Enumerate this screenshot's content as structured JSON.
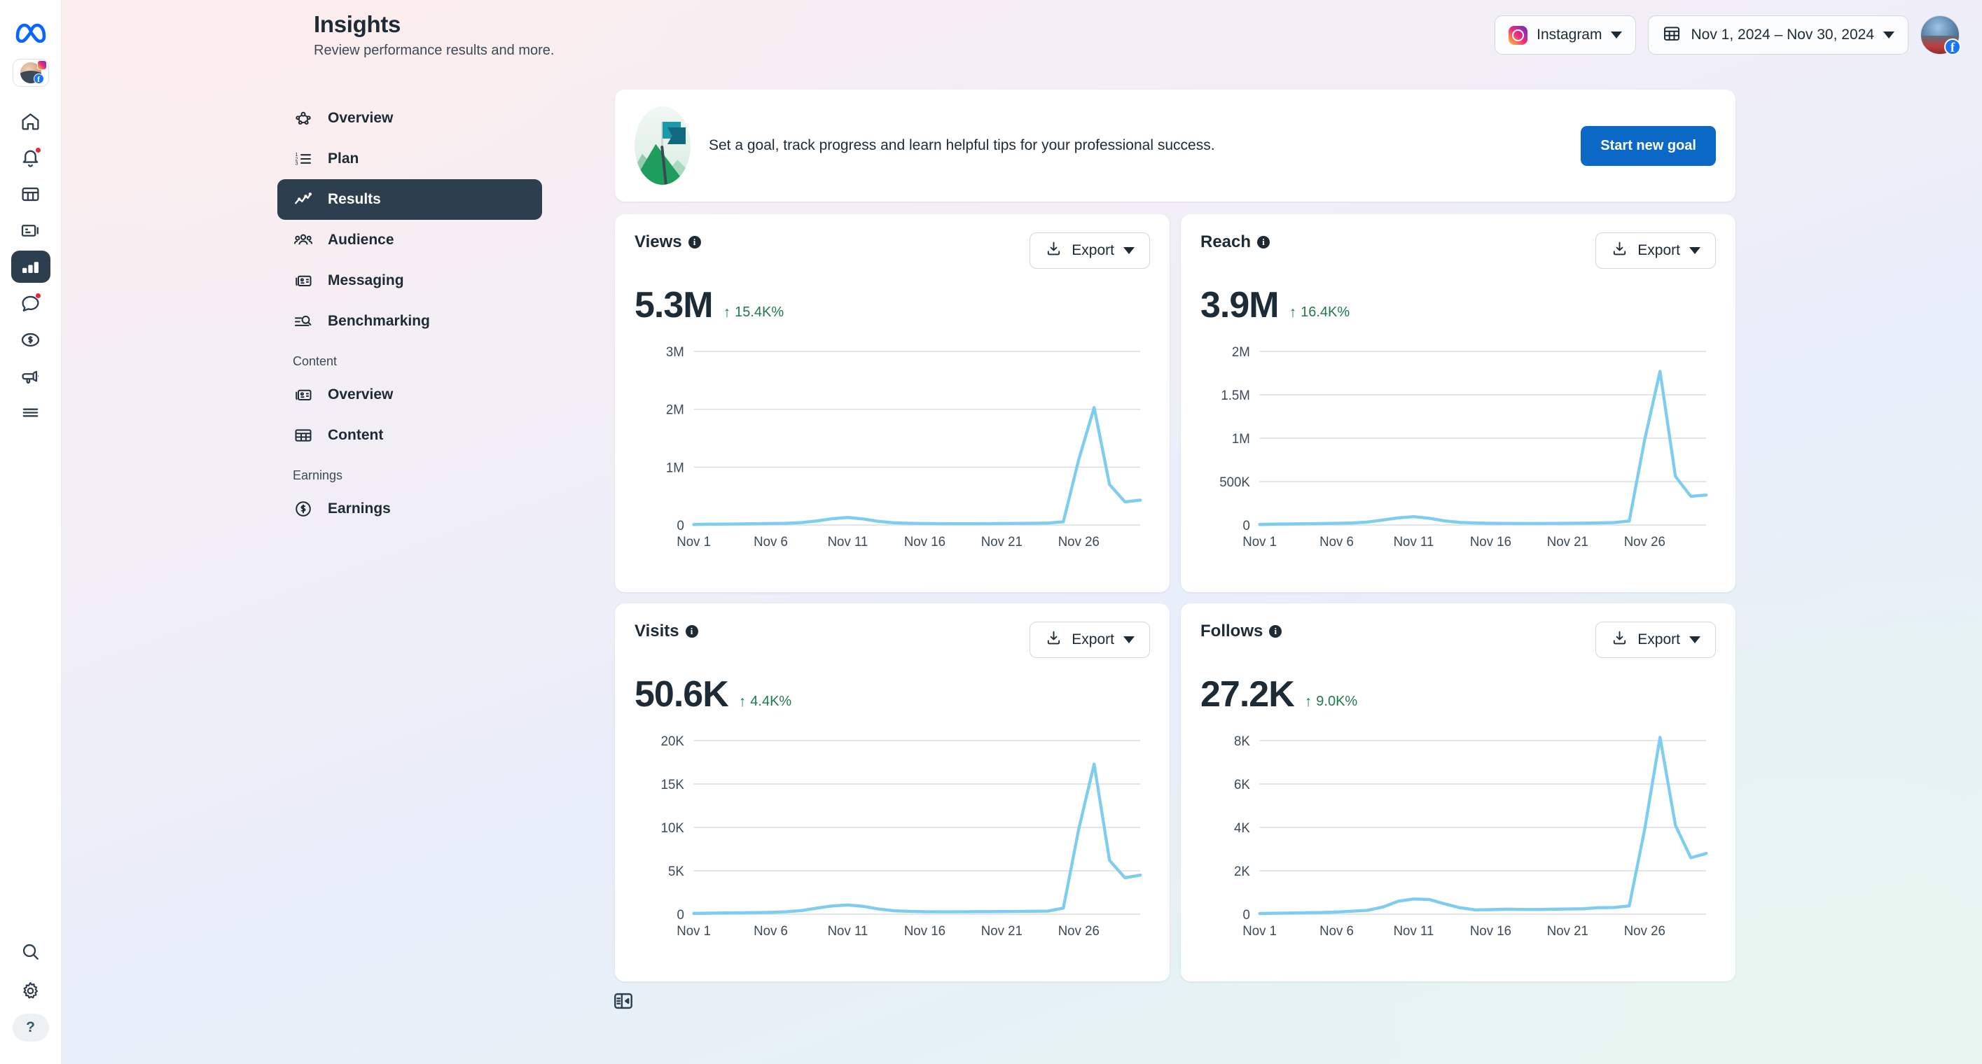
{
  "app": {
    "logo_icon": "meta-infinity-logo"
  },
  "rail": {
    "profile_icon": "profile-avatar-instagram",
    "items": [
      {
        "icon": "home-icon",
        "name": "home",
        "active": false,
        "badge": false
      },
      {
        "icon": "bell-icon",
        "name": "notifications",
        "active": false,
        "badge": true
      },
      {
        "icon": "grid-table-icon",
        "name": "planner",
        "active": false,
        "badge": false
      },
      {
        "icon": "card-icon",
        "name": "content",
        "active": false,
        "badge": false
      },
      {
        "icon": "bar-chart-icon",
        "name": "insights",
        "active": true,
        "badge": false
      },
      {
        "icon": "chat-bubble-icon",
        "name": "inbox",
        "active": false,
        "badge": true
      },
      {
        "icon": "dollar-circle-icon",
        "name": "monetization",
        "active": false,
        "badge": false
      },
      {
        "icon": "megaphone-icon",
        "name": "ads",
        "active": false,
        "badge": false
      },
      {
        "icon": "hamburger-menu-icon",
        "name": "all-tools",
        "active": false,
        "badge": false
      }
    ],
    "bottom": [
      {
        "icon": "search-icon",
        "name": "search"
      },
      {
        "icon": "gear-icon",
        "name": "settings"
      }
    ],
    "help_label": "?"
  },
  "header": {
    "title": "Insights",
    "subtitle": "Review performance results and more.",
    "account_selector": {
      "label": "Instagram",
      "icon": "instagram-icon"
    },
    "date_selector": {
      "label": "Nov 1, 2024 – Nov 30, 2024",
      "icon": "calendar-icon"
    },
    "avatar_icon": "user-avatar-facebook-badge"
  },
  "nav": {
    "items": [
      {
        "label": "Overview",
        "icon": "network-nodes-icon",
        "active": false
      },
      {
        "label": "Plan",
        "icon": "numbered-list-icon",
        "active": false
      },
      {
        "label": "Results",
        "icon": "line-chart-icon",
        "active": true
      },
      {
        "label": "Audience",
        "icon": "people-group-icon",
        "active": false
      },
      {
        "label": "Messaging",
        "icon": "cards-icon",
        "active": false
      },
      {
        "label": "Benchmarking",
        "icon": "list-search-icon",
        "active": false
      }
    ],
    "section_content_label": "Content",
    "content_items": [
      {
        "label": "Overview",
        "icon": "cards-icon",
        "active": false
      },
      {
        "label": "Content",
        "icon": "table-grid-icon",
        "active": false
      }
    ],
    "section_earnings_label": "Earnings",
    "earnings_items": [
      {
        "label": "Earnings",
        "icon": "dollar-circle-icon",
        "active": false
      }
    ],
    "panel_toggle_icon": "collapse-panel-icon"
  },
  "goal_banner": {
    "illustration_icon": "mountain-flag-illustration",
    "text": "Set a goal, track progress and learn helpful tips for your professional success.",
    "button_label": "Start new goal",
    "button_color": "#0c68c7"
  },
  "export_label": "Export",
  "export_icon": "download-icon",
  "colors": {
    "line": "#7fcdee",
    "positive": "#1e7a4b",
    "active_nav": "#2d3e4e",
    "accent": "#0c68c7"
  },
  "chart_data": [
    {
      "id": "views",
      "type": "line",
      "title": "Views",
      "value": "5.3M",
      "delta": "15.4K%",
      "delta_direction": "up",
      "xlabel": "",
      "ylabel": "",
      "ylim": [
        0,
        3000000
      ],
      "yticks": [
        0,
        1000000,
        2000000,
        3000000
      ],
      "ytick_labels": [
        "0",
        "1M",
        "2M",
        "3M"
      ],
      "xticks": [
        1,
        6,
        11,
        16,
        21,
        26
      ],
      "xtick_labels": [
        "Nov 1",
        "Nov 6",
        "Nov 11",
        "Nov 16",
        "Nov 21",
        "Nov 26"
      ],
      "x": [
        1,
        2,
        3,
        4,
        5,
        6,
        7,
        8,
        9,
        10,
        11,
        12,
        13,
        14,
        15,
        16,
        17,
        18,
        19,
        20,
        21,
        22,
        23,
        24,
        25,
        26,
        27,
        28,
        29,
        30
      ],
      "values": [
        8000,
        14000,
        16000,
        18000,
        22000,
        26000,
        30000,
        42000,
        70000,
        110000,
        130000,
        105000,
        62000,
        38000,
        30000,
        26000,
        24000,
        22000,
        22000,
        24000,
        26000,
        28000,
        30000,
        34000,
        55000,
        1130000,
        2030000,
        700000,
        400000,
        430000
      ],
      "grid": true
    },
    {
      "id": "reach",
      "type": "line",
      "title": "Reach",
      "value": "3.9M",
      "delta": "16.4K%",
      "delta_direction": "up",
      "xlabel": "",
      "ylabel": "",
      "ylim": [
        0,
        2000000
      ],
      "yticks": [
        0,
        500000,
        1000000,
        1500000,
        2000000
      ],
      "ytick_labels": [
        "0",
        "500K",
        "1M",
        "1.5M",
        "2M"
      ],
      "xticks": [
        1,
        6,
        11,
        16,
        21,
        26
      ],
      "xtick_labels": [
        "Nov 1",
        "Nov 6",
        "Nov 11",
        "Nov 16",
        "Nov 21",
        "Nov 26"
      ],
      "x": [
        1,
        2,
        3,
        4,
        5,
        6,
        7,
        8,
        9,
        10,
        11,
        12,
        13,
        14,
        15,
        16,
        17,
        18,
        19,
        20,
        21,
        22,
        23,
        24,
        25,
        26,
        27,
        28,
        29,
        30
      ],
      "values": [
        6000,
        10000,
        12000,
        14000,
        17000,
        20000,
        24000,
        34000,
        58000,
        82000,
        96000,
        78000,
        48000,
        30000,
        24000,
        20000,
        19000,
        18000,
        18000,
        19000,
        20000,
        22000,
        24000,
        28000,
        46000,
        980000,
        1770000,
        560000,
        330000,
        345000
      ],
      "grid": true
    },
    {
      "id": "visits",
      "type": "line",
      "title": "Visits",
      "value": "50.6K",
      "delta": "4.4K%",
      "delta_direction": "up",
      "xlabel": "",
      "ylabel": "",
      "ylim": [
        0,
        20000
      ],
      "yticks": [
        0,
        5000,
        10000,
        15000,
        20000
      ],
      "ytick_labels": [
        "0",
        "5K",
        "10K",
        "15K",
        "20K"
      ],
      "xticks": [
        1,
        6,
        11,
        16,
        21,
        26
      ],
      "xtick_labels": [
        "Nov 1",
        "Nov 6",
        "Nov 11",
        "Nov 16",
        "Nov 21",
        "Nov 26"
      ],
      "x": [
        1,
        2,
        3,
        4,
        5,
        6,
        7,
        8,
        9,
        10,
        11,
        12,
        13,
        14,
        15,
        16,
        17,
        18,
        19,
        20,
        21,
        22,
        23,
        24,
        25,
        26,
        27,
        28,
        29,
        30
      ],
      "values": [
        90,
        120,
        140,
        160,
        190,
        220,
        280,
        420,
        700,
        950,
        1060,
        900,
        600,
        400,
        330,
        290,
        280,
        280,
        290,
        300,
        310,
        320,
        340,
        360,
        700,
        9800,
        17300,
        6200,
        4200,
        4500
      ],
      "grid": true
    },
    {
      "id": "follows",
      "type": "line",
      "title": "Follows",
      "value": "27.2K",
      "delta": "9.0K%",
      "delta_direction": "up",
      "xlabel": "",
      "ylabel": "",
      "ylim": [
        0,
        8000
      ],
      "yticks": [
        0,
        2000,
        4000,
        6000,
        8000
      ],
      "ytick_labels": [
        "0",
        "2K",
        "4K",
        "6K",
        "8K"
      ],
      "xticks": [
        1,
        6,
        11,
        16,
        21,
        26
      ],
      "xtick_labels": [
        "Nov 1",
        "Nov 6",
        "Nov 11",
        "Nov 16",
        "Nov 21",
        "Nov 26"
      ],
      "x": [
        1,
        2,
        3,
        4,
        5,
        6,
        7,
        8,
        9,
        10,
        11,
        12,
        13,
        14,
        15,
        16,
        17,
        18,
        19,
        20,
        21,
        22,
        23,
        24,
        25,
        26,
        27,
        28,
        29,
        30
      ],
      "values": [
        30,
        45,
        55,
        65,
        80,
        100,
        140,
        180,
        330,
        600,
        700,
        680,
        480,
        300,
        200,
        210,
        230,
        220,
        215,
        230,
        240,
        250,
        300,
        310,
        380,
        3900,
        8150,
        4100,
        2600,
        2800
      ],
      "grid": true
    }
  ]
}
